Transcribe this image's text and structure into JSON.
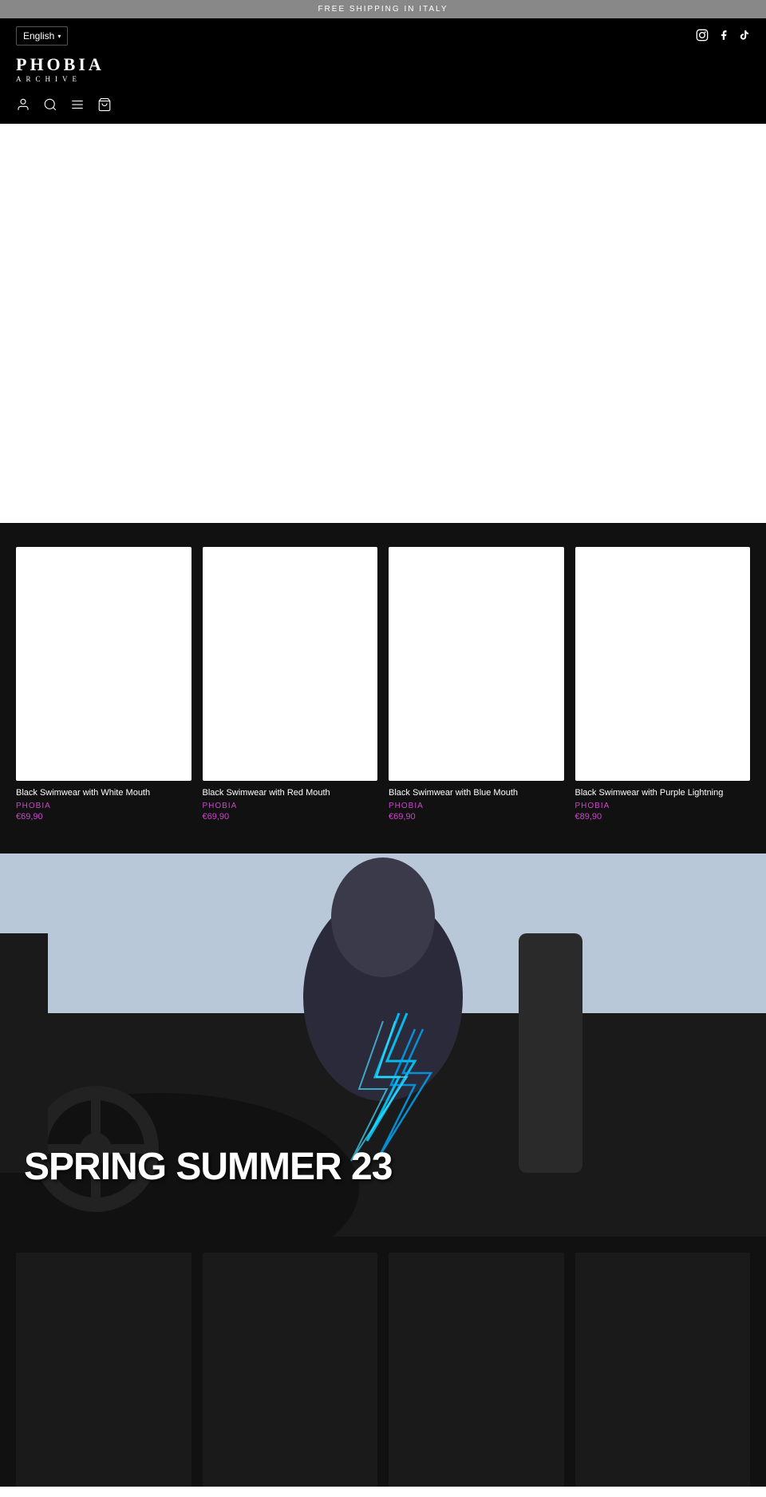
{
  "announcement": {
    "text": "FREE SHIPPING IN ITALY"
  },
  "header": {
    "language": "English",
    "language_chevron": "▾",
    "social": {
      "instagram": "instagram-icon",
      "facebook": "facebook-icon",
      "tiktok": "tiktok-icon"
    },
    "logo": {
      "line1": "PHOBIA",
      "line2": "ARCHIVE"
    },
    "nav_icons": {
      "account": "👤",
      "search": "🔍",
      "menu": "☰",
      "cart": "🛒"
    }
  },
  "products": {
    "items": [
      {
        "name": "Black Swimwear with White Mouth",
        "brand": "PHOBIA",
        "price": "€69,90"
      },
      {
        "name": "Black Swimwear with Red Mouth",
        "brand": "PHOBIA",
        "price": "€69,90"
      },
      {
        "name": "Black Swimwear with Blue Mouth",
        "brand": "PHOBIA",
        "price": "€69,90"
      },
      {
        "name": "Black Swimwear with Purple Lightning",
        "brand": "PHOBIA",
        "price": "€89,90"
      }
    ]
  },
  "campaign": {
    "title": "SPRING SUMMER 23"
  },
  "thumbnails": [
    {
      "id": 1
    },
    {
      "id": 2
    },
    {
      "id": 3
    },
    {
      "id": 4
    }
  ]
}
